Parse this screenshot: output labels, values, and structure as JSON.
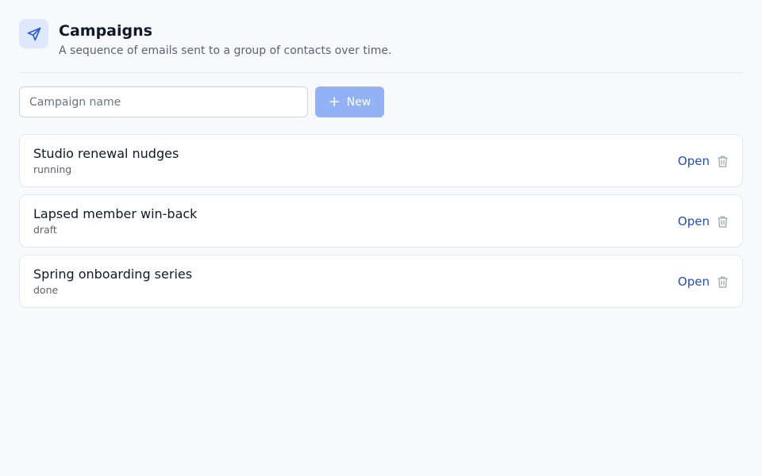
{
  "header": {
    "title": "Campaigns",
    "subtitle": "A sequence of emails sent to a group of contacts over time.",
    "icon": "send-icon"
  },
  "create": {
    "placeholder": "Campaign name",
    "value": "",
    "new_label": "New",
    "new_icon": "plus-icon"
  },
  "campaigns": [
    {
      "name": "Studio renewal nudges",
      "status": "running",
      "open_label": "Open",
      "delete_icon": "trash-icon"
    },
    {
      "name": "Lapsed member win-back",
      "status": "draft",
      "open_label": "Open",
      "delete_icon": "trash-icon"
    },
    {
      "name": "Spring onboarding series",
      "status": "done",
      "open_label": "Open",
      "delete_icon": "trash-icon"
    }
  ],
  "colors": {
    "background": "#f8f9fc",
    "accent": "#1f4fbf",
    "button_disabled": "#92b2f5",
    "icon_tile": "#dde8fc"
  }
}
